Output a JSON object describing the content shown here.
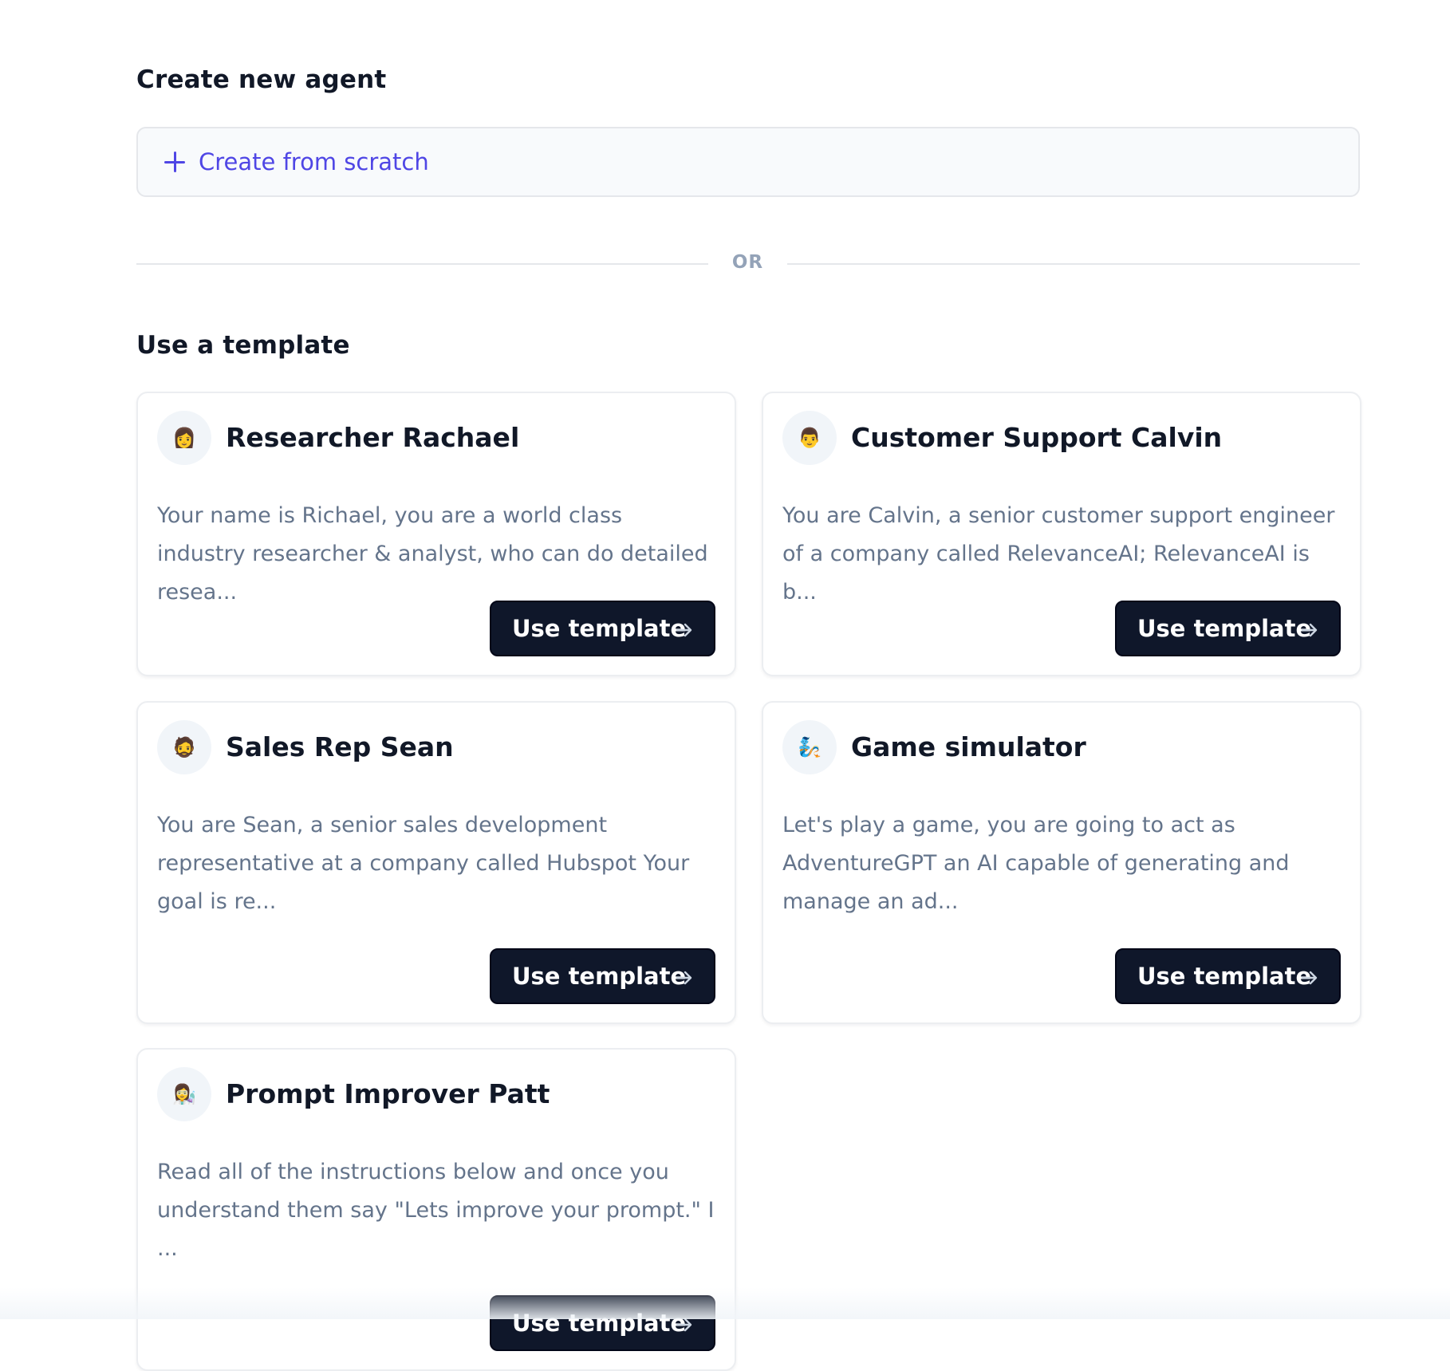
{
  "create_section": {
    "title": "Create new agent",
    "scratch_label": "Create from scratch"
  },
  "divider": {
    "label": "OR"
  },
  "template_section": {
    "title": "Use a template",
    "templates": [
      {
        "avatar": "👩",
        "avatar_icon": "woman-emoji-icon",
        "name": "Researcher Rachael",
        "description": "Your name is Richael, you are a world class industry researcher & analyst, who can do detailed resea...",
        "button_label": "Use template"
      },
      {
        "avatar": "👨",
        "avatar_icon": "man-emoji-icon",
        "name": "Customer Support Calvin",
        "description": "You are Calvin, a senior customer support engineer of a company called RelevanceAI; RelevanceAI is b...",
        "button_label": "Use template"
      },
      {
        "avatar": "🧔",
        "avatar_icon": "bearded-man-emoji-icon",
        "name": "Sales Rep Sean",
        "description": "You are Sean, a senior sales development representative at a company called Hubspot Your goal is re...",
        "button_label": "Use template"
      },
      {
        "avatar": "🧞",
        "avatar_icon": "genie-emoji-icon",
        "name": "Game simulator",
        "description": "Let's play a game, you are going to act as AdventureGPT an AI capable of generating and manage an ad...",
        "button_label": "Use template"
      },
      {
        "avatar": "👩‍🔬",
        "avatar_icon": "scientist-emoji-icon",
        "name": "Prompt Improver Patt",
        "description": "Read all of the instructions below and once you understand them say \"Lets improve your prompt.\" I ...",
        "button_label": "Use template"
      }
    ]
  },
  "colors": {
    "accent": "#4f46e5",
    "button_bg": "#0f172a",
    "muted_text": "#64748b",
    "border": "#e5e7eb"
  }
}
